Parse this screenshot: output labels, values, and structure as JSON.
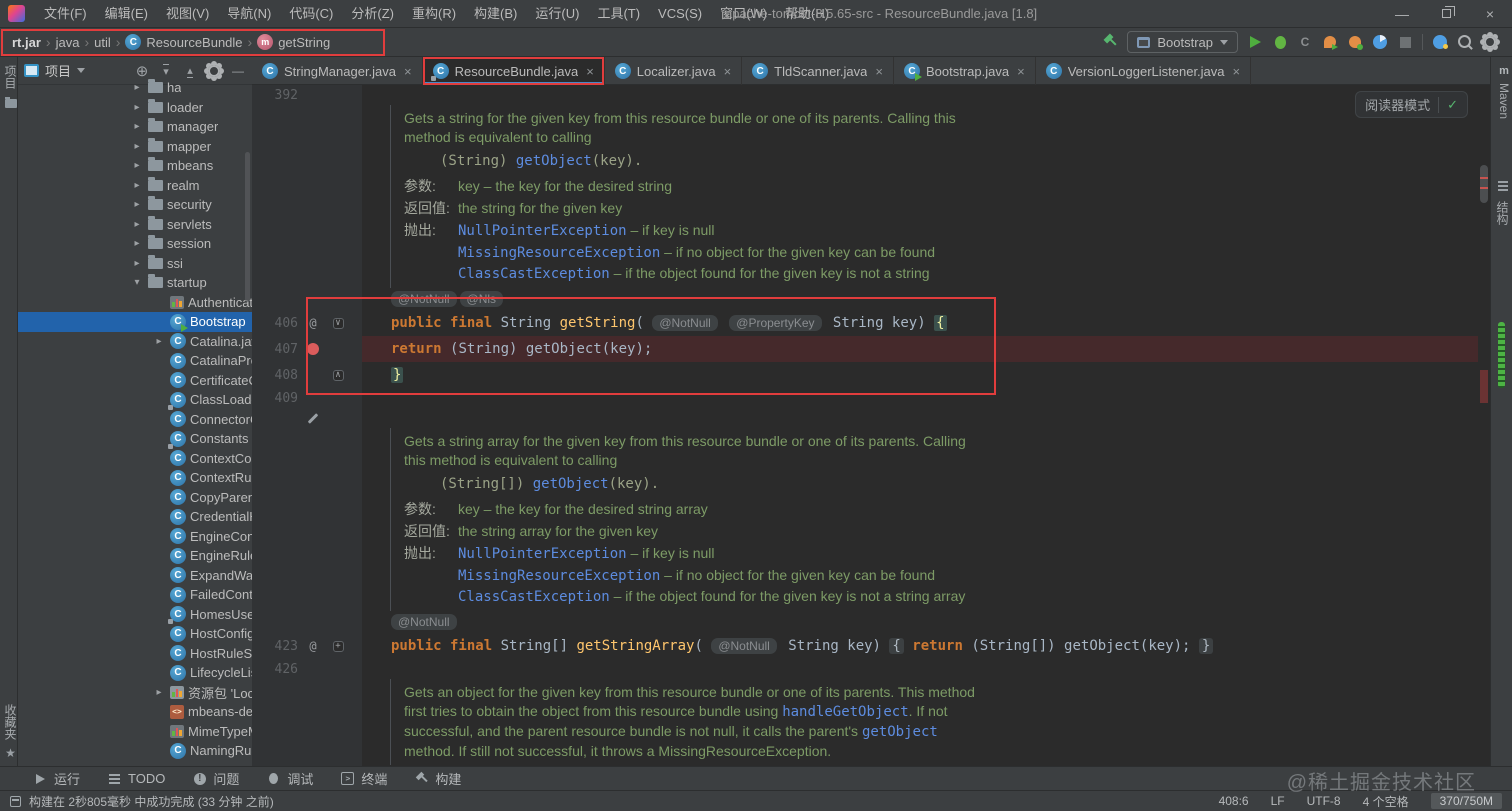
{
  "window": {
    "title": "apache-tomcat-8.5.65-src - ResourceBundle.java [1.8]"
  },
  "menu_bar": {
    "menus": [
      "文件(F)",
      "编辑(E)",
      "视图(V)",
      "导航(N)",
      "代码(C)",
      "分析(Z)",
      "重构(R)",
      "构建(B)",
      "运行(U)",
      "工具(T)",
      "VCS(S)",
      "窗口(W)",
      "帮助(H)"
    ]
  },
  "breadcrumb": {
    "items": [
      {
        "label": "rt.jar",
        "bold": true
      },
      {
        "label": "java"
      },
      {
        "label": "util"
      },
      {
        "label": "ResourceBundle",
        "icon": "class"
      },
      {
        "label": "getString",
        "icon": "method"
      }
    ]
  },
  "run_toolbar": {
    "config_name": "Bootstrap"
  },
  "tabs": [
    {
      "label": "StringManager.java",
      "icon": "class"
    },
    {
      "label": "ResourceBundle.java",
      "icon": "class-lock",
      "selected": true,
      "annotated": true
    },
    {
      "label": "Localizer.java",
      "icon": "class"
    },
    {
      "label": "TldScanner.java",
      "icon": "class"
    },
    {
      "label": "Bootstrap.java",
      "icon": "class-run"
    },
    {
      "label": "VersionLoggerListener.java",
      "icon": "class"
    }
  ],
  "left_strip": {
    "top": "项目",
    "bottom": "收藏夹"
  },
  "right_strip": {
    "maven": "Maven",
    "structure": "结构"
  },
  "project_panel": {
    "header_title": "项目",
    "tree": [
      {
        "label": "ha",
        "icon": "folder",
        "chevron": "right",
        "indent": 1
      },
      {
        "label": "loader",
        "icon": "folder",
        "chevron": "right",
        "indent": 1
      },
      {
        "label": "manager",
        "icon": "folder",
        "chevron": "right",
        "indent": 1
      },
      {
        "label": "mapper",
        "icon": "folder",
        "chevron": "right",
        "indent": 1
      },
      {
        "label": "mbeans",
        "icon": "folder",
        "chevron": "right",
        "indent": 1
      },
      {
        "label": "realm",
        "icon": "folder",
        "chevron": "right",
        "indent": 1
      },
      {
        "label": "security",
        "icon": "folder",
        "chevron": "right",
        "indent": 1
      },
      {
        "label": "servlets",
        "icon": "folder",
        "chevron": "right",
        "indent": 1
      },
      {
        "label": "session",
        "icon": "folder",
        "chevron": "right",
        "indent": 1
      },
      {
        "label": "ssi",
        "icon": "folder",
        "chevron": "right",
        "indent": 1
      },
      {
        "label": "startup",
        "icon": "folder",
        "chevron": "down",
        "indent": 1
      },
      {
        "label": "Authenticator",
        "icon": "props",
        "indent": 2
      },
      {
        "label": "Bootstrap",
        "icon": "class-run",
        "indent": 2,
        "selected": true
      },
      {
        "label": "Catalina.java",
        "icon": "class",
        "chevron": "right",
        "indent": 2
      },
      {
        "label": "CatalinaPrope",
        "icon": "class",
        "indent": 2
      },
      {
        "label": "CertificateCre",
        "icon": "class",
        "indent": 2
      },
      {
        "label": "ClassLoaderFa",
        "icon": "class-lock",
        "indent": 2
      },
      {
        "label": "ConnectorCre",
        "icon": "class",
        "indent": 2
      },
      {
        "label": "Constants",
        "icon": "class-lock",
        "indent": 2
      },
      {
        "label": "ContextConfig",
        "icon": "class",
        "indent": 2
      },
      {
        "label": "ContextRuleSe",
        "icon": "class",
        "indent": 2
      },
      {
        "label": "CopyParentCla",
        "icon": "class",
        "indent": 2
      },
      {
        "label": "CredentialHan",
        "icon": "class",
        "indent": 2
      },
      {
        "label": "EngineConfig",
        "icon": "class",
        "indent": 2
      },
      {
        "label": "EngineRuleSet",
        "icon": "class",
        "indent": 2
      },
      {
        "label": "ExpandWar",
        "icon": "class",
        "indent": 2
      },
      {
        "label": "FailedContext",
        "icon": "class",
        "indent": 2
      },
      {
        "label": "HomesUserDa",
        "icon": "class-lock",
        "indent": 2
      },
      {
        "label": "HostConfig",
        "icon": "class",
        "indent": 2
      },
      {
        "label": "HostRuleSet",
        "icon": "class",
        "indent": 2
      },
      {
        "label": "LifecycleListe",
        "icon": "class",
        "indent": 2
      },
      {
        "label": "资源包 'LocalSt",
        "icon": "bundle",
        "chevron": "right",
        "indent": 2
      },
      {
        "label": "mbeans-descr",
        "icon": "xml",
        "indent": 2
      },
      {
        "label": "MimeTypeMa",
        "icon": "props",
        "indent": 2
      },
      {
        "label": "NamingRuleSe",
        "icon": "class",
        "indent": 2
      }
    ]
  },
  "editor": {
    "reader_mode_label": "阅读器模式",
    "chip_lines": [
      [
        "@NotNull",
        "@Nls"
      ],
      [
        "@NotNull"
      ]
    ],
    "token_lines": [
      [
        {
          "t": "public final ",
          "c": "kw"
        },
        {
          "t": "String ",
          "c": "t"
        },
        {
          "t": "getString",
          "c": "fn"
        },
        {
          "t": "( ",
          "c": "t"
        },
        {
          "t": "@NotNull",
          "c": "chip"
        },
        {
          "t": " ",
          "c": "t"
        },
        {
          "t": "@PropertyKey",
          "c": "chip"
        },
        {
          "t": " String key) ",
          "c": "t"
        },
        {
          "t": "{",
          "c": "brace"
        }
      ],
      [
        {
          "t": "return ",
          "c": "kw"
        },
        {
          "t": "(String) getObject(key);",
          "c": "t"
        }
      ],
      [
        {
          "t": "}",
          "c": "brace"
        }
      ],
      [
        {
          "t": "public final ",
          "c": "kw"
        },
        {
          "t": "String[] ",
          "c": "t"
        },
        {
          "t": "getStringArray",
          "c": "fn"
        },
        {
          "t": "( ",
          "c": "t"
        },
        {
          "t": "@NotNull",
          "c": "chip"
        },
        {
          "t": " String key) ",
          "c": "t"
        },
        {
          "t": "{",
          "c": "foldb"
        },
        {
          "t": " ",
          "c": "t"
        },
        {
          "t": "return ",
          "c": "kw"
        },
        {
          "t": "(String[]) getObject(key); ",
          "c": "t"
        },
        {
          "t": "}",
          "c": "foldb"
        }
      ]
    ],
    "docs": [
      {
        "lines": [
          {
            "k": "p",
            "runs": [
              {
                "t": "Gets a string for the given key from this resource bundle or one of its parents. Calling this"
              }
            ]
          },
          {
            "k": "p",
            "runs": [
              {
                "t": "method is equivalent to calling"
              }
            ]
          },
          {
            "k": "code",
            "runs": [
              {
                "t": "(String) ",
                "c": "code"
              },
              {
                "t": "getObject",
                "c": "link"
              },
              {
                "t": "(key).",
                "c": "code"
              }
            ]
          },
          {
            "k": "param",
            "label": "参数:",
            "runs": [
              {
                "t": "key – the key for the desired string"
              }
            ]
          },
          {
            "k": "param",
            "label": "返回值:",
            "runs": [
              {
                "t": "the string for the given key"
              }
            ]
          },
          {
            "k": "param",
            "label": "抛出:",
            "runs": [
              {
                "t": "NullPointerException",
                "c": "link"
              },
              {
                "t": " – if key is null"
              }
            ]
          },
          {
            "k": "cont",
            "label": "",
            "runs": [
              {
                "t": "MissingResourceException",
                "c": "link"
              },
              {
                "t": " – if no object for the given key can be found"
              }
            ]
          },
          {
            "k": "cont",
            "label": "",
            "runs": [
              {
                "t": "ClassCastException",
                "c": "link"
              },
              {
                "t": " – if the object found for the given key is not a string"
              }
            ]
          }
        ]
      },
      {
        "lines": [
          {
            "k": "p",
            "runs": [
              {
                "t": "Gets a string array for the given key from this resource bundle or one of its parents. Calling"
              }
            ]
          },
          {
            "k": "p",
            "runs": [
              {
                "t": "this method is equivalent to calling"
              }
            ]
          },
          {
            "k": "code",
            "runs": [
              {
                "t": "(String[]) ",
                "c": "code"
              },
              {
                "t": "getObject",
                "c": "link"
              },
              {
                "t": "(key).",
                "c": "code"
              }
            ]
          },
          {
            "k": "param",
            "label": "参数:",
            "runs": [
              {
                "t": "key – the key for the desired string array"
              }
            ]
          },
          {
            "k": "param",
            "label": "返回值:",
            "runs": [
              {
                "t": "the string array for the given key"
              }
            ]
          },
          {
            "k": "param",
            "label": "抛出:",
            "runs": [
              {
                "t": "NullPointerException",
                "c": "link"
              },
              {
                "t": " – if key is null"
              }
            ]
          },
          {
            "k": "cont",
            "label": "",
            "runs": [
              {
                "t": "MissingResourceException",
                "c": "link"
              },
              {
                "t": " – if no object for the given key can be found"
              }
            ]
          },
          {
            "k": "cont",
            "label": "",
            "runs": [
              {
                "t": "ClassCastException",
                "c": "link"
              },
              {
                "t": " – if the object found for the given key is not a string array"
              }
            ]
          }
        ]
      },
      {
        "lines": [
          {
            "k": "p",
            "runs": [
              {
                "t": "Gets an object for the given key from this resource bundle or one of its parents. This method"
              }
            ]
          },
          {
            "k": "p",
            "runs": [
              {
                "t": "first tries to obtain the object from this resource bundle using "
              },
              {
                "t": "handleGetObject",
                "c": "link"
              },
              {
                "t": ". If not"
              }
            ]
          },
          {
            "k": "p",
            "runs": [
              {
                "t": "successful, and the parent resource bundle is not null, it calls the parent's "
              },
              {
                "t": "getObject",
                "c": "link"
              }
            ]
          },
          {
            "k": "p",
            "runs": [
              {
                "t": "method. If still not successful, it throws a MissingResourceException."
              }
            ]
          }
        ]
      }
    ],
    "rows": [
      {
        "type": "num",
        "num": "392"
      },
      {
        "type": "doc",
        "doc": 0
      },
      {
        "type": "chips",
        "chips": 0
      },
      {
        "type": "code",
        "num": "406",
        "at": true,
        "fold": "open",
        "tokens": 0
      },
      {
        "type": "code",
        "num": "407",
        "bp": true,
        "hl": true,
        "tokens": 1
      },
      {
        "type": "code",
        "num": "408",
        "fold": "close",
        "tokens": 2
      },
      {
        "type": "num",
        "num": "409"
      },
      {
        "type": "gap",
        "icon": "pencil"
      },
      {
        "type": "doc",
        "doc": 1
      },
      {
        "type": "chips",
        "chips": 1
      },
      {
        "type": "code",
        "num": "423",
        "at": true,
        "fold": "plus",
        "tokens": 3
      },
      {
        "type": "num",
        "num": "426"
      },
      {
        "type": "doc",
        "doc": 2
      }
    ]
  },
  "tool_window_bar": {
    "items": [
      {
        "label": "运行",
        "icon": "run"
      },
      {
        "label": "TODO",
        "icon": "todo"
      },
      {
        "label": "问题",
        "icon": "problems"
      },
      {
        "label": "调试",
        "icon": "debug"
      },
      {
        "label": "终端",
        "icon": "terminal"
      },
      {
        "label": "构建",
        "icon": "build"
      }
    ]
  },
  "status_bar": {
    "message": "构建在 2秒805毫秒 中成功完成 (33 分钟 之前)",
    "caret": "408:6",
    "line_separator": "LF",
    "encoding": "UTF-8",
    "indent": "4 个空格",
    "memory": "370/750M"
  },
  "watermark": "@稀土掘金技术社区",
  "colors": {
    "selection_blue": "#2263ab",
    "annotation_red": "#e13d3d",
    "tab_underline": "#4a88c7",
    "breakpoint_line": "#45292b",
    "breakpoint_dot": "#db5c5c",
    "keyword_orange": "#cc7832",
    "method_yellow": "#ffc66d",
    "doc_green": "#7d9b66",
    "link_blue": "#5d8ce0",
    "editor_bg": "#2b2b2b",
    "panel_bg": "#3c3f41"
  }
}
